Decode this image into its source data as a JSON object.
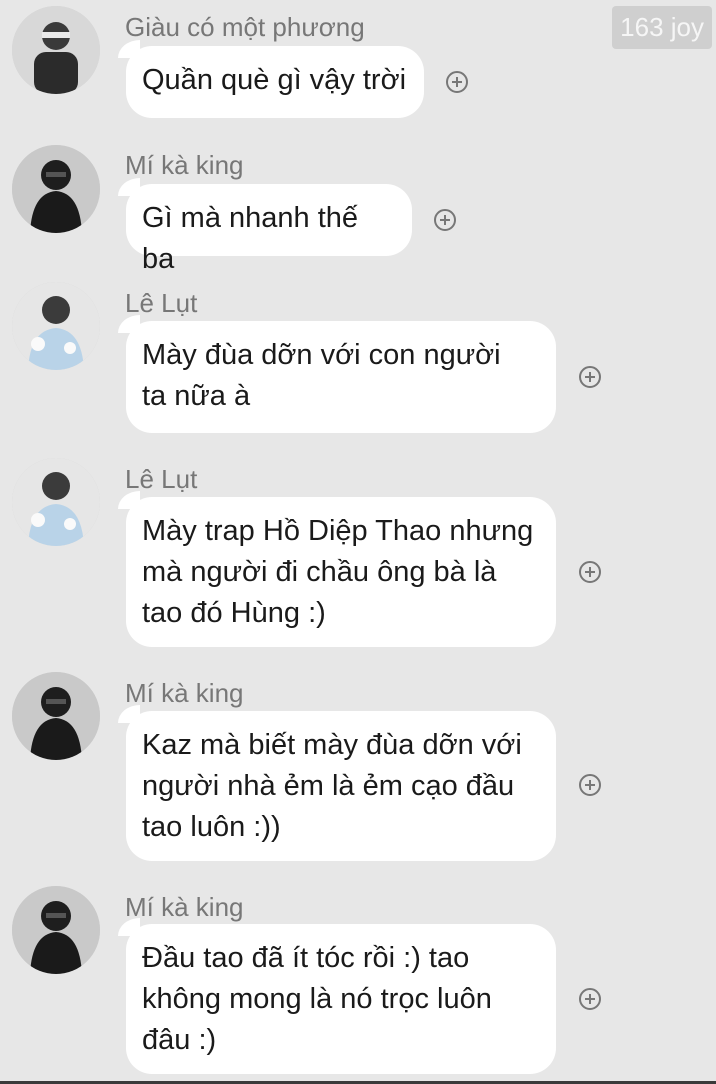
{
  "watermark": "163 joy",
  "messages": [
    {
      "sender": "Giàu có một phương",
      "avatar": "avatar-user-white-outfit",
      "text": "Quần què gì vậy trời"
    },
    {
      "sender": "Mí kà king",
      "avatar": "avatar-user-black-hoodie",
      "text": "Gì mà nhanh thế ba"
    },
    {
      "sender": "Lê Lụt",
      "avatar": "avatar-user-light-jacket",
      "text": "Mày đùa dỡn với con người\nta nữa à"
    },
    {
      "sender": "Lê Lụt",
      "avatar": "avatar-user-light-jacket",
      "text": "Mày trap Hồ Diệp Thao nhưng\nmà người đi chầu ông bà là\ntao đó Hùng :)"
    },
    {
      "sender": "Mí kà king",
      "avatar": "avatar-user-black-hoodie",
      "text": "Kaz mà biết mày đùa dỡn với\nngười nhà ẻm là ẻm cạo đầu\ntao luôn :))"
    },
    {
      "sender": "Mí kà king",
      "avatar": "avatar-user-black-hoodie",
      "text": "Đầu tao đã ít tóc rồi :) tao\nkhông mong là nó trọc luôn\nđâu :)"
    }
  ],
  "icons": {
    "reaction": "plus-circle-icon"
  }
}
